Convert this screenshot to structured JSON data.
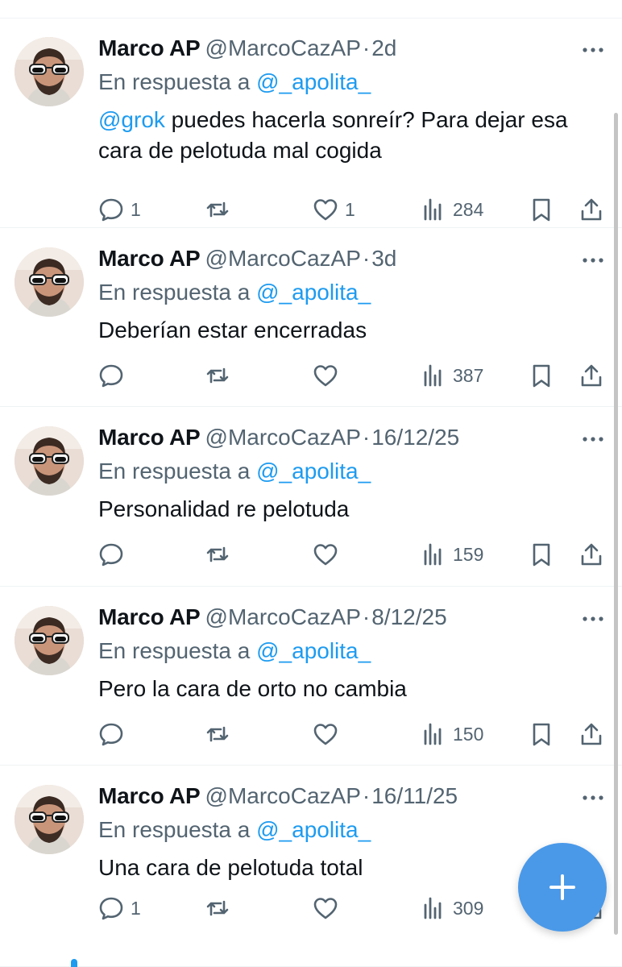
{
  "colors": {
    "accent": "#1d9bf0",
    "fab": "#4a99e9",
    "secondary_text": "#536471",
    "primary_text": "#0f1419"
  },
  "tweets": [
    {
      "name": "Marco AP",
      "handle": "@MarcoCazAP",
      "separator": "·",
      "time": "2d",
      "reply_prefix": "En respuesta a",
      "reply_to": "@_apolita_",
      "mention": "@grok",
      "text": " puedes hacerla sonreír? Para dejar esa cara de pelotuda mal cogida",
      "replies": "1",
      "retweets": "",
      "likes": "1",
      "views": "284"
    },
    {
      "name": "Marco AP",
      "handle": "@MarcoCazAP",
      "separator": "·",
      "time": "3d",
      "reply_prefix": "En respuesta a",
      "reply_to": "@_apolita_",
      "mention": "",
      "text": "Deberían estar encerradas",
      "replies": "",
      "retweets": "",
      "likes": "",
      "views": "387"
    },
    {
      "name": "Marco AP",
      "handle": "@MarcoCazAP",
      "separator": "·",
      "time": "16/12/25",
      "reply_prefix": "En respuesta a",
      "reply_to": "@_apolita_",
      "mention": "",
      "text": "Personalidad re pelotuda",
      "replies": "",
      "retweets": "",
      "likes": "",
      "views": "159"
    },
    {
      "name": "Marco AP",
      "handle": "@MarcoCazAP",
      "separator": "·",
      "time": "8/12/25",
      "reply_prefix": "En respuesta a",
      "reply_to": "@_apolita_",
      "mention": "",
      "text": "Pero la cara de orto no cambia",
      "replies": "",
      "retweets": "",
      "likes": "",
      "views": "150"
    },
    {
      "name": "Marco AP",
      "handle": "@MarcoCazAP",
      "separator": "·",
      "time": "16/11/25",
      "reply_prefix": "En respuesta a",
      "reply_to": "@_apolita_",
      "mention": "",
      "text": "Una cara de pelotuda total",
      "replies": "1",
      "retweets": "",
      "likes": "",
      "views": "309"
    }
  ],
  "icons": {
    "more": "more-horizontal-icon",
    "reply": "reply-icon",
    "retweet": "retweet-icon",
    "like": "heart-icon",
    "views": "views-icon",
    "bookmark": "bookmark-icon",
    "share": "share-icon",
    "compose": "plus-icon"
  }
}
